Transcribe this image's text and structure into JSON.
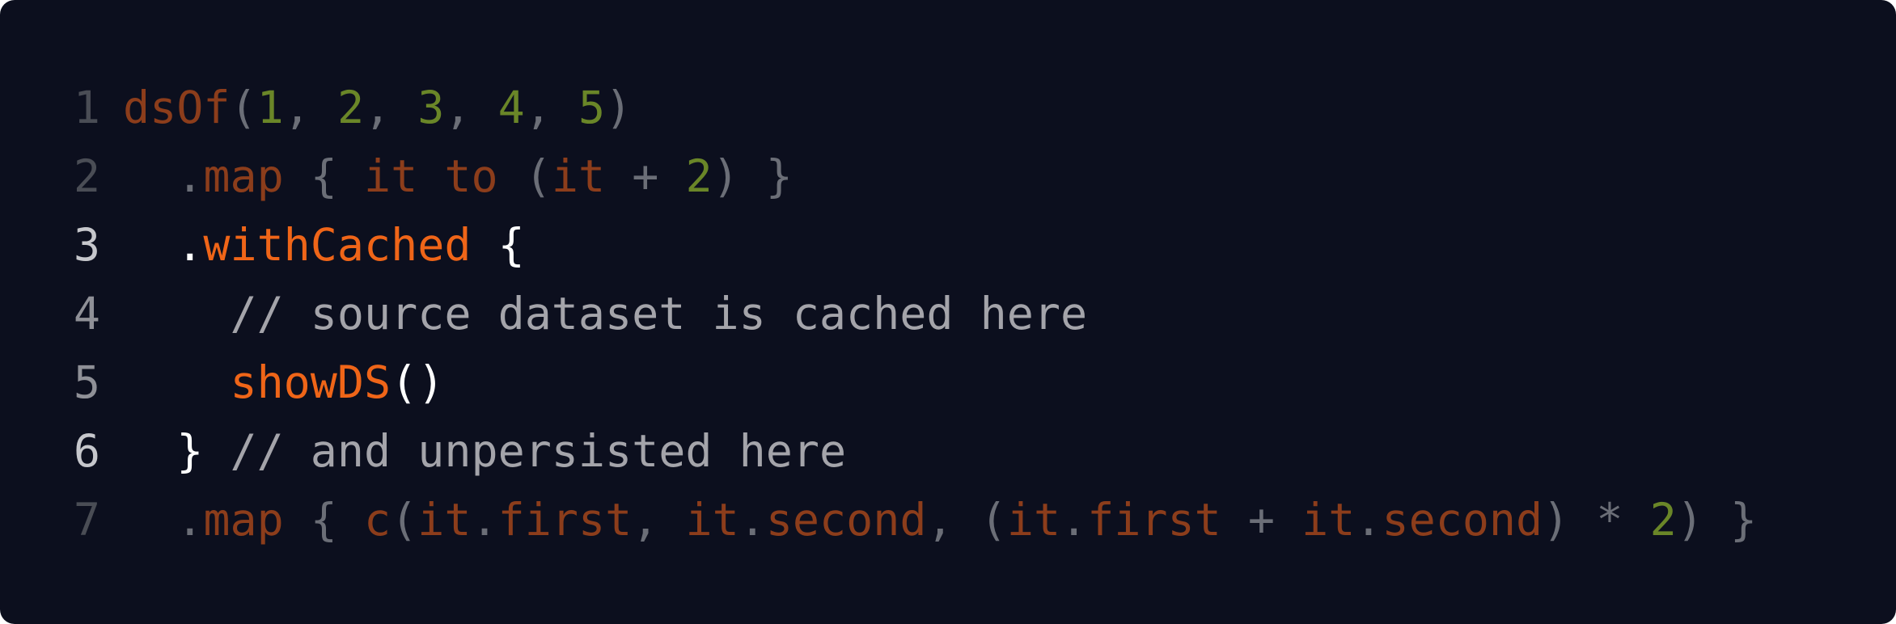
{
  "colors": {
    "background": "#0c0f1e",
    "keyword_dim": "#8c3d1b",
    "keyword_active": "#ef6518",
    "number": "#6a8628",
    "punctuation_dim": "#6b6e77",
    "punctuation_active": "#ffffff",
    "comment": "#a4a4aa"
  },
  "code_lines": [
    {
      "number": "1",
      "state": "dim",
      "tokens": [
        {
          "text": "dsOf",
          "kind": "ident"
        },
        {
          "text": "(",
          "kind": "punct"
        },
        {
          "text": "1",
          "kind": "num"
        },
        {
          "text": ", ",
          "kind": "punct"
        },
        {
          "text": "2",
          "kind": "num"
        },
        {
          "text": ", ",
          "kind": "punct"
        },
        {
          "text": "3",
          "kind": "num"
        },
        {
          "text": ", ",
          "kind": "punct"
        },
        {
          "text": "4",
          "kind": "num"
        },
        {
          "text": ", ",
          "kind": "punct"
        },
        {
          "text": "5",
          "kind": "num"
        },
        {
          "text": ")",
          "kind": "punct"
        }
      ]
    },
    {
      "number": "2",
      "state": "dim",
      "tokens": [
        {
          "text": "  .",
          "kind": "punct"
        },
        {
          "text": "map",
          "kind": "ident"
        },
        {
          "text": " { ",
          "kind": "punct"
        },
        {
          "text": "it",
          "kind": "ident"
        },
        {
          "text": " ",
          "kind": "punct"
        },
        {
          "text": "to",
          "kind": "ident"
        },
        {
          "text": " (",
          "kind": "punct"
        },
        {
          "text": "it",
          "kind": "ident"
        },
        {
          "text": " + ",
          "kind": "punct"
        },
        {
          "text": "2",
          "kind": "num"
        },
        {
          "text": ") }",
          "kind": "punct"
        }
      ]
    },
    {
      "number": "3",
      "state": "bright",
      "tokens": [
        {
          "text": "  .",
          "kind": "punct_active"
        },
        {
          "text": "withCached",
          "kind": "ident_active"
        },
        {
          "text": " {",
          "kind": "punct_active"
        }
      ]
    },
    {
      "number": "4",
      "state": "focus",
      "tokens": [
        {
          "text": "    // source dataset is cached here",
          "kind": "comment"
        }
      ]
    },
    {
      "number": "5",
      "state": "focus",
      "tokens": [
        {
          "text": "    ",
          "kind": "punct_active"
        },
        {
          "text": "showDS",
          "kind": "ident_active"
        },
        {
          "text": "()",
          "kind": "punct_active"
        }
      ]
    },
    {
      "number": "6",
      "state": "bright",
      "tokens": [
        {
          "text": "  }",
          "kind": "punct_active"
        },
        {
          "text": " // and unpersisted here",
          "kind": "comment"
        }
      ]
    },
    {
      "number": "7",
      "state": "dim",
      "tokens": [
        {
          "text": "  .",
          "kind": "punct"
        },
        {
          "text": "map",
          "kind": "ident"
        },
        {
          "text": " { ",
          "kind": "punct"
        },
        {
          "text": "c",
          "kind": "ident"
        },
        {
          "text": "(",
          "kind": "punct"
        },
        {
          "text": "it",
          "kind": "ident"
        },
        {
          "text": ".",
          "kind": "punct"
        },
        {
          "text": "first",
          "kind": "ident"
        },
        {
          "text": ", ",
          "kind": "punct"
        },
        {
          "text": "it",
          "kind": "ident"
        },
        {
          "text": ".",
          "kind": "punct"
        },
        {
          "text": "second",
          "kind": "ident"
        },
        {
          "text": ", (",
          "kind": "punct"
        },
        {
          "text": "it",
          "kind": "ident"
        },
        {
          "text": ".",
          "kind": "punct"
        },
        {
          "text": "first",
          "kind": "ident"
        },
        {
          "text": " + ",
          "kind": "punct"
        },
        {
          "text": "it",
          "kind": "ident"
        },
        {
          "text": ".",
          "kind": "punct"
        },
        {
          "text": "second",
          "kind": "ident"
        },
        {
          "text": ") * ",
          "kind": "punct"
        },
        {
          "text": "2",
          "kind": "num"
        },
        {
          "text": ") }",
          "kind": "punct"
        }
      ]
    }
  ]
}
